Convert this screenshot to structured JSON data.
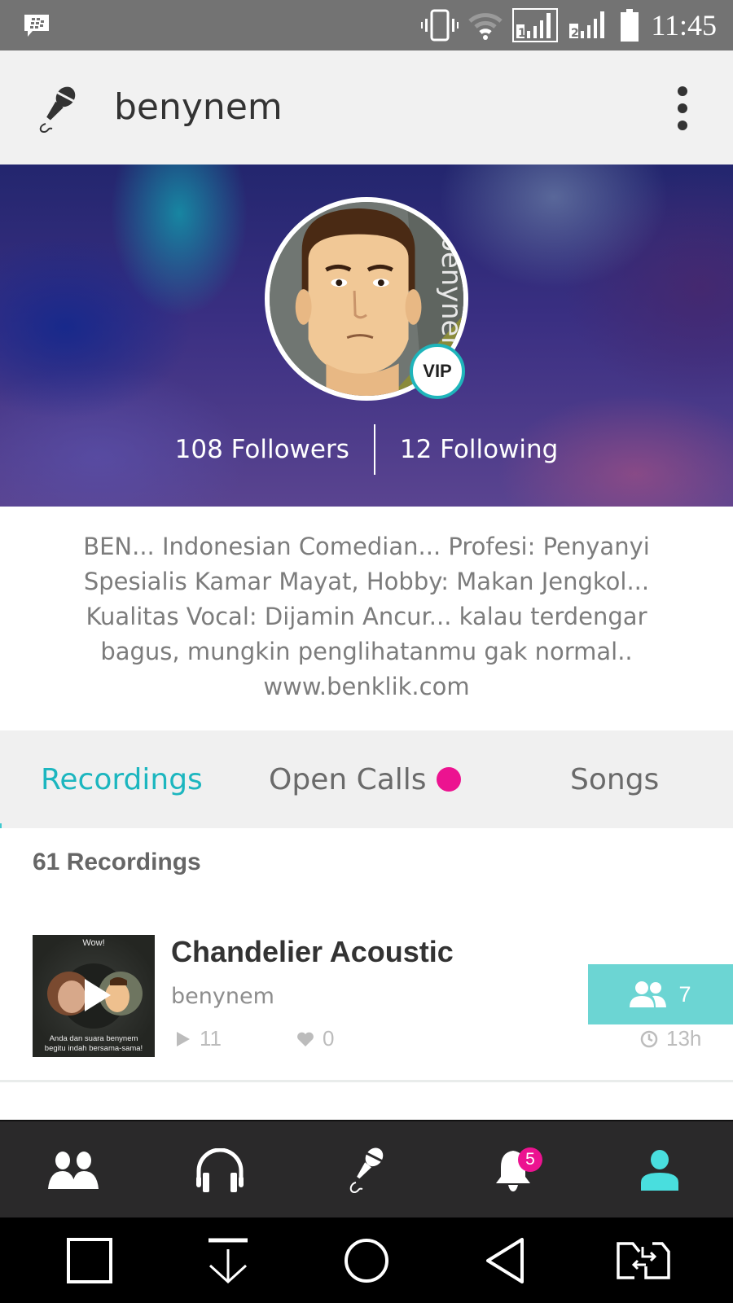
{
  "status_bar": {
    "time": "11:45",
    "icons": [
      "bbm-icon",
      "vibrate-icon",
      "wifi-icon",
      "sim1-signal-icon",
      "sim2-signal-icon",
      "battery-icon"
    ],
    "sim1_label": "1",
    "sim2_label": "2"
  },
  "app_bar": {
    "title": "benynem",
    "left_icon": "microphone-icon",
    "right_icon": "more-vert-icon"
  },
  "profile": {
    "avatar_text": "benynem",
    "vip_label": "VIP",
    "followers": "108 Followers",
    "following": "12 Following",
    "bio_lines": [
      "BEN... Indonesian Comedian... Profesi: Penyanyi",
      "Spesialis Kamar Mayat, Hobby: Makan Jengkol...",
      "Kualitas Vocal: Dijamin Ancur... kalau terdengar",
      "bagus, mungkin penglihatanmu gak normal.."
    ],
    "website": "www.benklik.com"
  },
  "tabs": [
    {
      "label": "Recordings",
      "active": true
    },
    {
      "label": "Open Calls",
      "active": false,
      "has_dot": true
    },
    {
      "label": "Songs",
      "active": false
    }
  ],
  "recordings": {
    "count_label": "61 Recordings",
    "items": [
      {
        "title": "Chandelier Acoustic",
        "artist": "benynem",
        "plays": "11",
        "likes": "0",
        "joins": "7",
        "age": "13h",
        "thumb_top": "Wow!",
        "thumb_caption_1": "Anda dan suara benynem",
        "thumb_caption_2": "begitu indah bersama-sama!"
      }
    ]
  },
  "bottom_nav": {
    "items": [
      {
        "name": "social",
        "icon": "people-icon"
      },
      {
        "name": "listen",
        "icon": "headphones-icon"
      },
      {
        "name": "sing",
        "icon": "microphone-icon"
      },
      {
        "name": "notifications",
        "icon": "bell-icon",
        "badge": "5"
      },
      {
        "name": "profile",
        "icon": "person-icon",
        "active": true
      }
    ]
  },
  "system_nav": {
    "items": [
      "recents-icon",
      "notification-pull-icon",
      "home-icon",
      "back-icon",
      "sim-switch-icon"
    ]
  },
  "colors": {
    "accent": "#1cb6bf",
    "badge": "#ec1390",
    "collab_button": "#6cd5d3",
    "nav_bg": "#2a292a",
    "status_bar": "#737373"
  }
}
